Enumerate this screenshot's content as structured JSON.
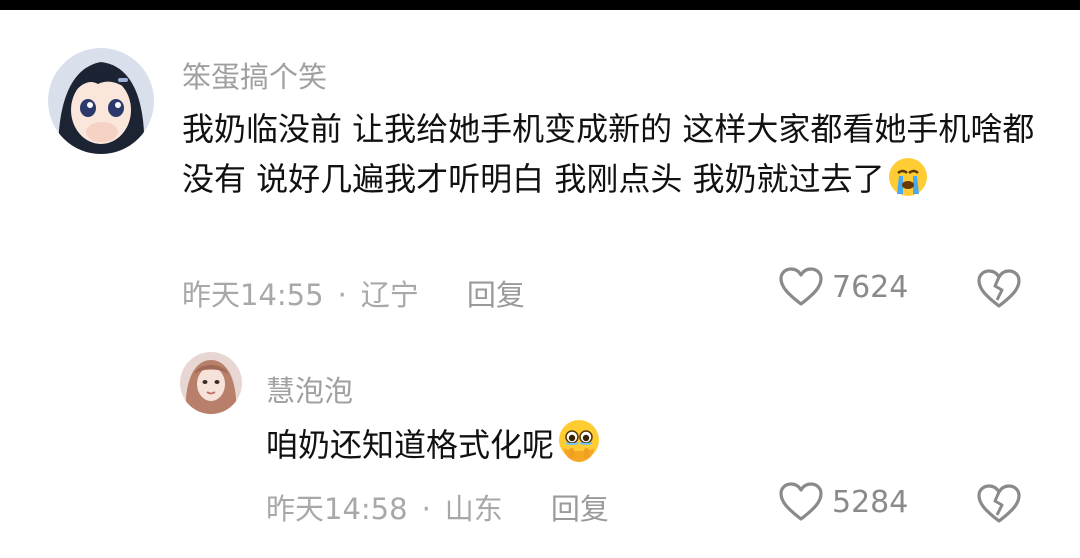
{
  "comments": [
    {
      "username": "笨蛋搞个笑",
      "text": "我奶临没前 让我给她手机变成新的 这样大家都看她手机啥都没有 说好几遍我才听明白 我刚点头 我奶就过去了",
      "emoji": "loudly-crying-face-emoji",
      "time": "昨天14:55",
      "separator": "·",
      "location": "辽宁",
      "reply_label": "回复",
      "likes": "7624",
      "like_icon": "heart-outline-icon",
      "dislike_icon": "broken-heart-icon"
    },
    {
      "username": "慧泡泡",
      "text": "咱奶还知道格式化呢",
      "emoji": "face-holding-back-tears-emoji",
      "time": "昨天14:58",
      "separator": "·",
      "location": "山东",
      "reply_label": "回复",
      "likes": "5284",
      "like_icon": "heart-outline-icon",
      "dislike_icon": "broken-heart-icon"
    }
  ],
  "colors": {
    "username": "#a0a0a0",
    "text": "#111111",
    "meta": "#a8a8a8",
    "icon": "#8a8a8a"
  }
}
